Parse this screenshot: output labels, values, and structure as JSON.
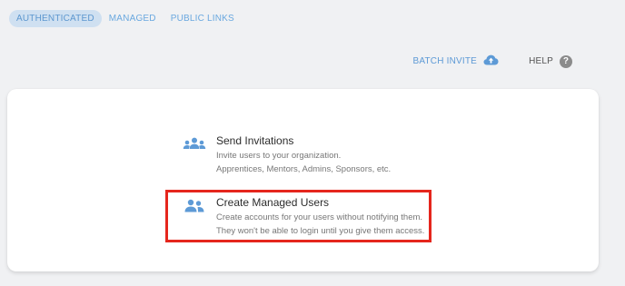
{
  "tabs": [
    {
      "label": "AUTHENTICATED",
      "active": true
    },
    {
      "label": "MANAGED",
      "active": false
    },
    {
      "label": "PUBLIC LINKS",
      "active": false
    }
  ],
  "actions": {
    "batch_invite": "BATCH INVITE",
    "help": "HELP",
    "help_glyph": "?"
  },
  "options": [
    {
      "title": "Send Invitations",
      "desc_line1": "Invite users to your organization.",
      "desc_line2": "Apprentices, Mentors, Admins, Sponsors, etc.",
      "icon": "group-icon"
    },
    {
      "title": "Create Managed Users",
      "desc_line1": "Create accounts for your users without notifying them.",
      "desc_line2": "They won't be able to login until you give them access.",
      "icon": "users-icon"
    }
  ],
  "colors": {
    "accent": "#5d9ad6",
    "highlight": "#e5261d",
    "tab_active_bg": "#cfe0f1",
    "background": "#f0f1f3"
  }
}
